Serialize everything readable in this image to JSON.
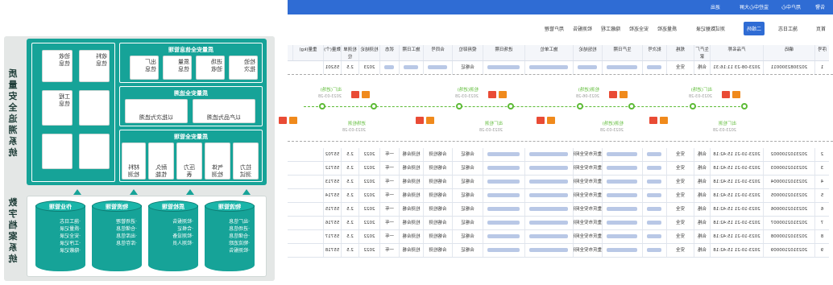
{
  "topbar": {
    "items": [
      "告警",
      "用户中心",
      "监控中心大屏",
      "退出"
    ]
  },
  "tabs": [
    "首页",
    "施工日志",
    "隐蔽工程",
    "安全巡检",
    "质量巡检",
    "测试数据记录",
    "检测报告",
    "二维码",
    "用户管理"
  ],
  "tabs_active": "二维码",
  "table": {
    "headers": [
      "序号",
      "编码",
      "产品名称",
      "生产厂家",
      "规格",
      "批次号",
      "生产日期",
      "检验结论",
      "施工单位",
      "进场日期",
      "使用部位",
      "合同号",
      "施工日期",
      "状态",
      "检测结论",
      "检测单位",
      "数量(个)",
      "重量(kg)"
    ],
    "rows": [
      [
        "1",
        "2023082300011",
        "2023-08-23 11:16:31",
        "合格",
        "安全",
        "",
        "",
        "",
        "",
        "",
        "合格证",
        "",
        "",
        "",
        "2023",
        "2.5",
        "55201"
      ],
      [
        "2",
        "2023102100002",
        "2023-10-21 15:42:18",
        "合格",
        "安全",
        "",
        "",
        "重庆市安全网有限公司",
        "",
        "",
        "合格证",
        "合格检测",
        "检测合格",
        "一年",
        "2022",
        "2.5",
        "55702"
      ],
      [
        "3",
        "2023102100003",
        "2023-10-21 15:42:18",
        "合格",
        "安全",
        "",
        "",
        "重庆市安全网有限公司",
        "",
        "",
        "合格证",
        "合格检测",
        "检测合格",
        "一年",
        "2022",
        "2.5",
        "55712"
      ],
      [
        "4",
        "2023102100004",
        "2023-10-21 15:42:18",
        "合格",
        "安全",
        "",
        "",
        "重庆市安全网有限公司",
        "",
        "",
        "合格证",
        "合格检测",
        "检测合格",
        "一年",
        "2022",
        "2.5",
        "55713"
      ],
      [
        "5",
        "2023102100005",
        "2023-10-21 15:42:18",
        "合格",
        "安全",
        "",
        "",
        "重庆市安全网有限公司",
        "",
        "",
        "合格证",
        "合格检测",
        "检测合格",
        "一年",
        "2022",
        "2.5",
        "55714"
      ],
      [
        "6",
        "2023102100006",
        "2023-10-21 15:42:18",
        "合格",
        "安全",
        "",
        "",
        "重庆市安全网有限公司",
        "",
        "",
        "合格证",
        "合格检测",
        "检测合格",
        "一年",
        "2022",
        "2.5",
        "55715"
      ],
      [
        "7",
        "2023102100007",
        "2023-10-21 15:42:18",
        "合格",
        "安全",
        "",
        "",
        "重庆市安全网有限公司",
        "",
        "",
        "合格证",
        "合格检测",
        "检测合格",
        "一年",
        "2022",
        "2.5",
        "55716"
      ],
      [
        "8",
        "2023102100008",
        "2023-10-21 15:42:18",
        "合格",
        "安全",
        "",
        "",
        "重庆市安全网有限公司",
        "",
        "",
        "合格证",
        "合格检测",
        "检测合格",
        "一年",
        "2022",
        "2.5",
        "55717"
      ],
      [
        "9",
        "2023102100009",
        "2023-10-21 15:42:18",
        "合格",
        "安全",
        "",
        "",
        "重庆市安全网有限公司",
        "",
        "",
        "合格证",
        "合格检测",
        "检测合格",
        "一年",
        "2022",
        "2.5",
        "55718"
      ]
    ]
  },
  "timeline": {
    "top": [
      {
        "label": "出厂(进场)",
        "date": "2023-03-28"
      },
      {
        "label": "检测(进场)",
        "date": "2023-06-28"
      },
      {
        "label": "检测(进场)",
        "date": "2023-03-28"
      },
      {
        "label": "出厂(进场)",
        "date": "2023-03-28"
      }
    ],
    "bottom": [
      {
        "label": "出厂检测",
        "date": "2023-03-28"
      },
      {
        "label": "检测(进场)",
        "date": "2023-03-28"
      },
      {
        "label": "出厂检测",
        "date": "2023-03-28"
      },
      {
        "label": "进场检测",
        "date": "2023-03-28"
      }
    ]
  },
  "diagram": {
    "title_top": "质量安全追溯系统",
    "title_bottom": "数字档案系统",
    "panel1": {
      "title": "质量安全信息管理",
      "cards": [
        "检验\n批次",
        "进场\n验收",
        "质量\n信息",
        "出厂\n信息"
      ]
    },
    "panel1_right": [
      "收料\n信息",
      "验收\n信息",
      "工程\n信息"
    ],
    "panel2": {
      "title": "质量安全追溯",
      "cards": [
        "以产品为追溯",
        "以批次为追溯"
      ]
    },
    "panel3": {
      "title": "质量安全管理",
      "cards": [
        "拉力\n测试",
        "气体\n检测",
        "压力\n表",
        "耐久\n性能",
        "材料\n检测"
      ]
    },
    "cylinders": [
      {
        "title": "物流管理",
        "lines": "·出厂信息\n·进场信息\n·仓储信息\n·物流追踪\n·检测报告"
      },
      {
        "title": "质检管理",
        "lines": "·检测报告\n·合格证\n·检测设备\n·检测人员"
      },
      {
        "title": "物资管理",
        "lines": "·进场管理\n·仓储信息\n·出库信息\n·库存信息"
      },
      {
        "title": "作业管理",
        "lines": "·施工日志\n·质量记录\n·安全记录\n·工序记录\n·隐蔽记录"
      }
    ]
  }
}
